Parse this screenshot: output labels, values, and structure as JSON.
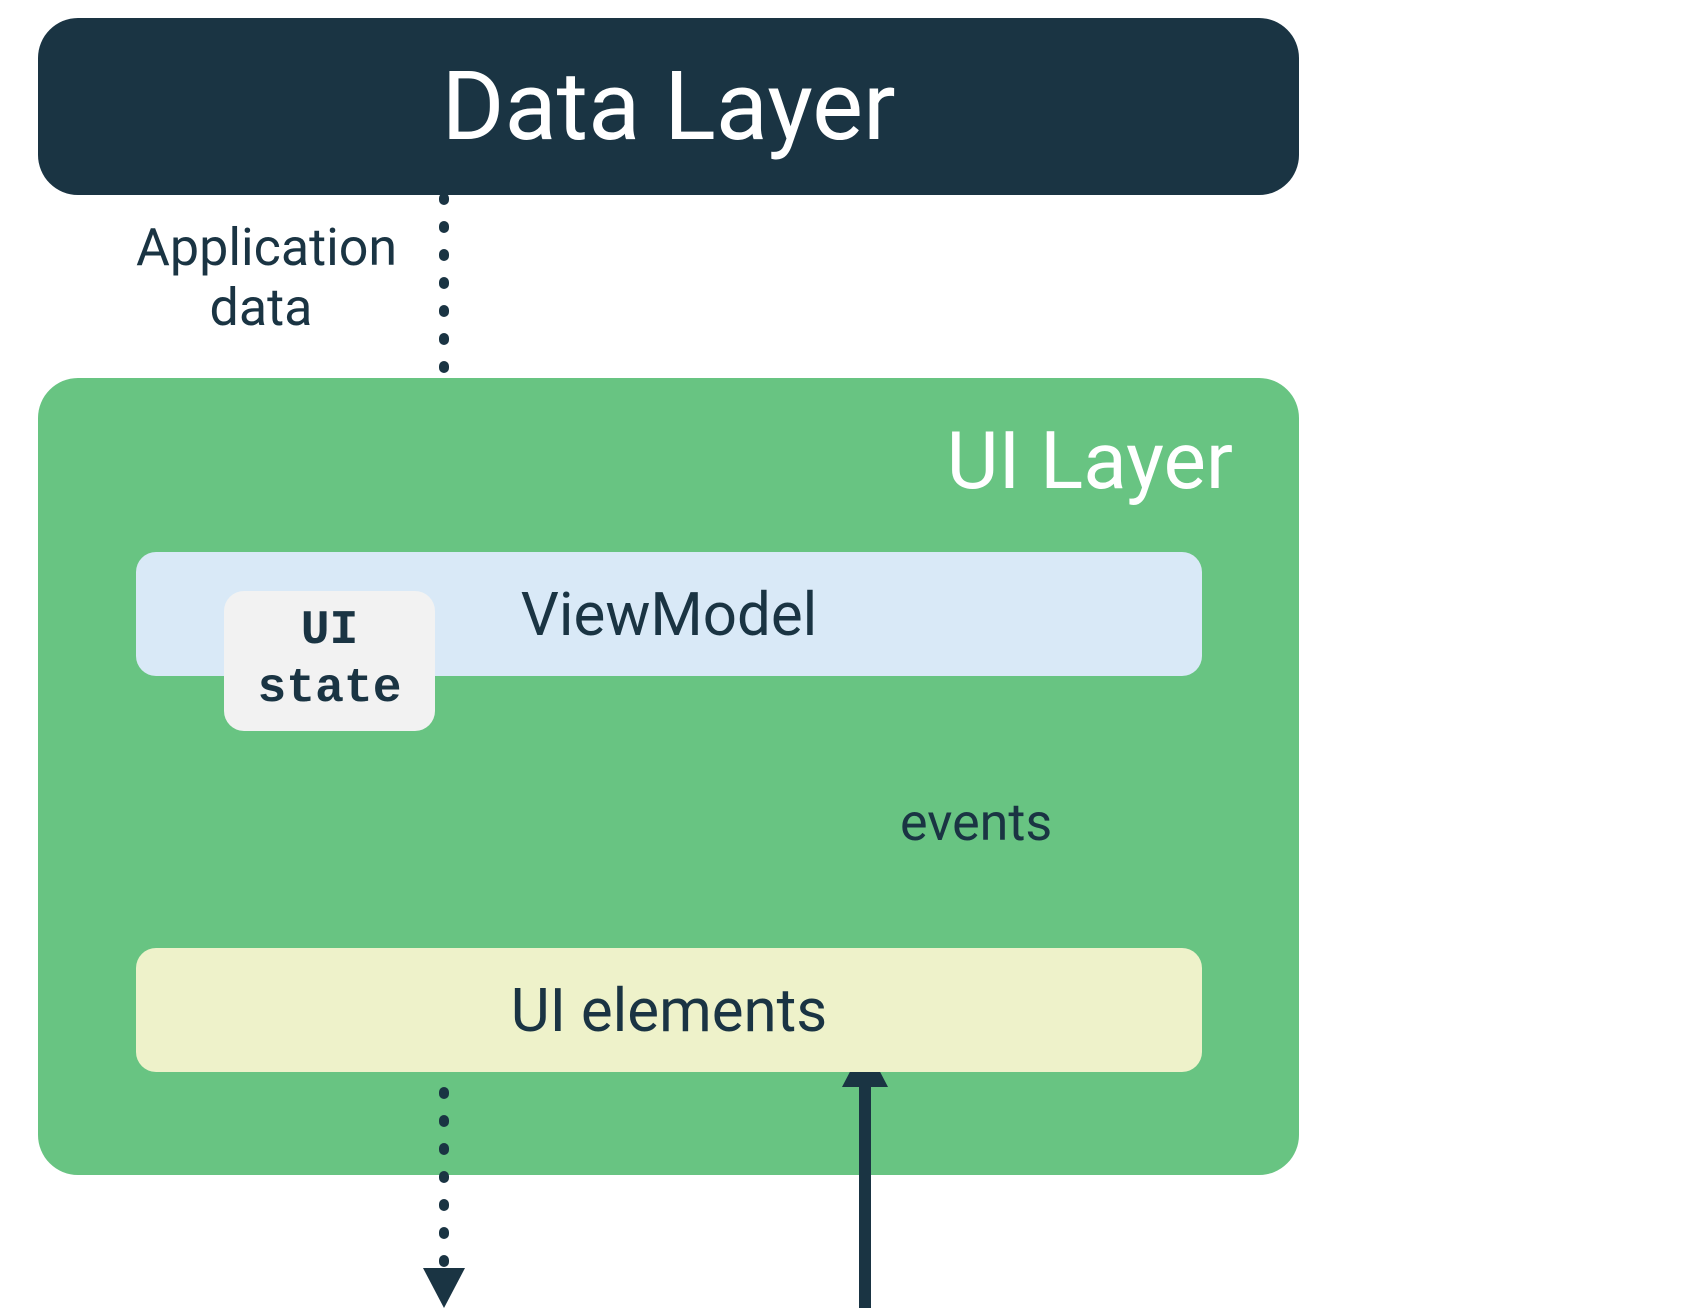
{
  "diagram": {
    "data_layer": {
      "label": "Data Layer"
    },
    "arrows": {
      "app_data_label": "Application data",
      "events_label": "events"
    },
    "ui_layer": {
      "label": "UI Layer",
      "viewmodel": {
        "label": "ViewModel"
      },
      "ui_state": {
        "line1": "UI",
        "line2": "state"
      },
      "ui_elements": {
        "label": "UI elements"
      }
    },
    "colors": {
      "dark_navy": "#1a3443",
      "green": "#68c482",
      "light_blue": "#d9e9f7",
      "light_grey": "#f2f2f2",
      "light_yellow": "#eef2ca",
      "white": "#ffffff"
    }
  }
}
